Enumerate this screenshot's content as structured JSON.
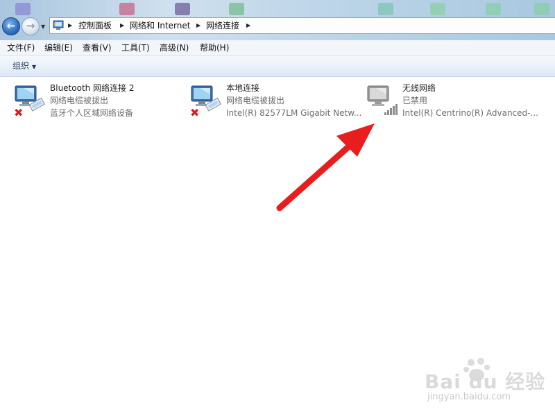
{
  "address": {
    "crumbs": [
      {
        "label": "控制面板"
      },
      {
        "label": "网络和 Internet"
      },
      {
        "label": "网络连接"
      }
    ]
  },
  "menubar": {
    "items": [
      {
        "label": "文件(F)"
      },
      {
        "label": "编辑(E)"
      },
      {
        "label": "查看(V)"
      },
      {
        "label": "工具(T)"
      },
      {
        "label": "高级(N)"
      },
      {
        "label": "帮助(H)"
      }
    ]
  },
  "toolbar": {
    "organize_label": "组织"
  },
  "connections": [
    {
      "name": "Bluetooth 网络连接 2",
      "status": "网络电缆被拔出",
      "device": "蓝牙个人区域网络设备",
      "icon": "network-adapter-disconnected-icon"
    },
    {
      "name": "本地连接",
      "status": "网络电缆被拔出",
      "device": "Intel(R) 82577LM Gigabit Netw...",
      "icon": "network-adapter-disconnected-icon"
    },
    {
      "name": "无线网络",
      "status": "已禁用",
      "device": "Intel(R) Centrino(R) Advanced-...",
      "icon": "wireless-adapter-disabled-icon"
    }
  ],
  "watermark": {
    "logo": "Bai du 经验",
    "url": "jingyan.baidu.com"
  },
  "colors": {
    "annotation_arrow": "#e81e1e",
    "command_text": "#1e395b"
  }
}
